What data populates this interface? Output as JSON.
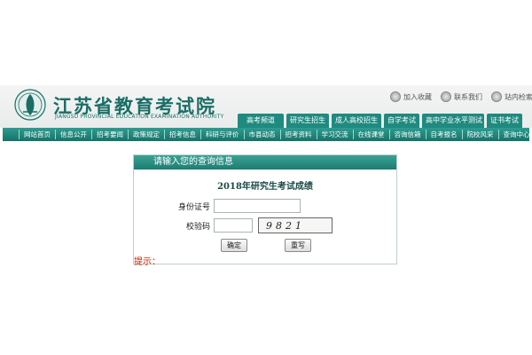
{
  "header": {
    "title": "江苏省教育考试院",
    "subtitle": "JIANGSU PROVINCIAL EDUCATION EXAMINATION AUTHORITY",
    "logo_icon": "jseea-logo",
    "top_links": [
      {
        "label": "加入收藏",
        "icon": "favorite-circle-icon"
      },
      {
        "label": "联系我们",
        "icon": "contact-circle-icon"
      },
      {
        "label": "站内检索",
        "icon": "search-circle-icon"
      }
    ],
    "category_tabs": [
      "高考频道",
      "研究生招生",
      "成人高校招生",
      "自学考试",
      "高中学业水平测试",
      "证书考试"
    ]
  },
  "nav": {
    "items": [
      "网站首页",
      "信息公开",
      "招考要闻",
      "政策规定",
      "招考信息",
      "科研与评价",
      "市县动态",
      "招考资料",
      "学习交流",
      "在线课堂",
      "咨询信箱",
      "自考报名",
      "院校风采",
      "查询中心"
    ]
  },
  "query": {
    "header": "请输入您的查询信息",
    "title": "2018年研究生考试成绩",
    "id_label": "身份证号",
    "id_value": "",
    "code_label": "校验码",
    "code_value": "",
    "captcha_text": "9821",
    "confirm_label": "确定",
    "reset_label": "重写"
  },
  "hint": "提示："
}
